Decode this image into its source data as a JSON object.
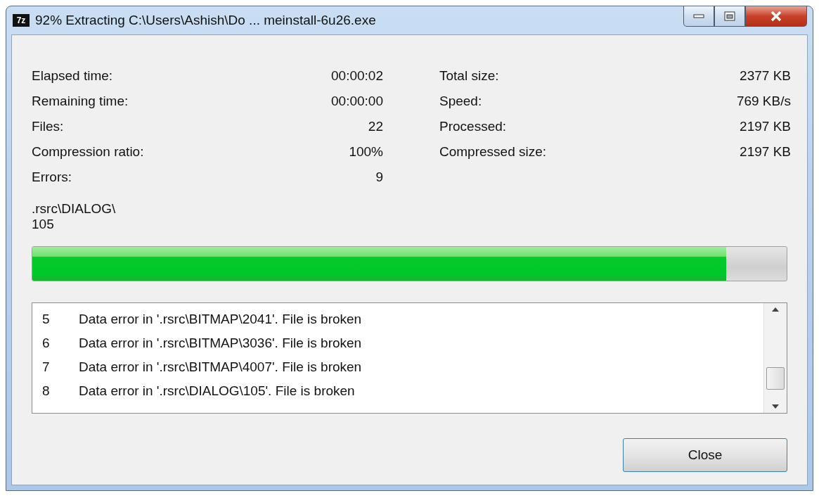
{
  "window": {
    "title": "92% Extracting C:\\Users\\Ashish\\Do ... meinstall-6u26.exe",
    "app_icon": "7z"
  },
  "stats_left": [
    {
      "label": "Elapsed time:",
      "value": "00:00:02"
    },
    {
      "label": "Remaining time:",
      "value": "00:00:00"
    },
    {
      "label": "Files:",
      "value": "22"
    },
    {
      "label": "Compression ratio:",
      "value": "100%"
    },
    {
      "label": "Errors:",
      "value": "9"
    }
  ],
  "stats_right": [
    {
      "label": "Total size:",
      "value": "2377 KB"
    },
    {
      "label": "Speed:",
      "value": "769 KB/s"
    },
    {
      "label": "Processed:",
      "value": "2197 KB"
    },
    {
      "label": "Compressed size:",
      "value": "2197 KB"
    }
  ],
  "current_file": [
    ".rsrc\\DIALOG\\",
    "105"
  ],
  "progress": {
    "level": 0.92
  },
  "log": [
    {
      "number": "5",
      "message": "Data error in '.rsrc\\BITMAP\\2041'. File is broken"
    },
    {
      "number": "6",
      "message": "Data error in '.rsrc\\BITMAP\\3036'. File is broken"
    },
    {
      "number": "7",
      "message": "Data error in '.rsrc\\BITMAP\\4007'. File is broken"
    },
    {
      "number": "8",
      "message": "Data error in '.rsrc\\DIALOG\\105'. File is broken"
    }
  ],
  "buttons": [
    "Close"
  ]
}
